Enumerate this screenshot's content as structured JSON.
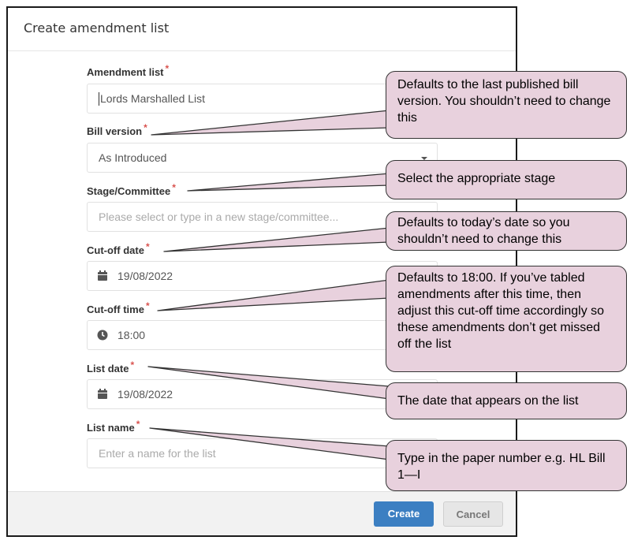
{
  "dialog": {
    "title": "Create amendment list",
    "required_mark": "*",
    "fields": {
      "amendment_list": {
        "label": "Amendment list",
        "value": "Lords Marshalled List"
      },
      "bill_version": {
        "label": "Bill version",
        "value": "As Introduced"
      },
      "stage": {
        "label": "Stage/Committee",
        "placeholder": "Please select or type in a new stage/committee..."
      },
      "cutoff_date": {
        "label": "Cut-off date",
        "value": "19/08/2022"
      },
      "cutoff_time": {
        "label": "Cut-off time",
        "value": "18:00"
      },
      "list_date": {
        "label": "List date",
        "value": "19/08/2022"
      },
      "list_name": {
        "label": "List name",
        "placeholder": "Enter a name for the list"
      }
    },
    "buttons": {
      "create": "Create",
      "cancel": "Cancel"
    }
  },
  "callouts": {
    "bill_version": "Defaults to the last published bill version.  You shouldn’t need to change this",
    "stage": "Select the appropriate stage",
    "cutoff_date": "Defaults to today’s date so you shouldn’t need to change this",
    "cutoff_time": "Defaults to 18:00.  If you’ve tabled amendments after this time, then adjust this cut-off time accordingly so these amendments don’t get missed off the list",
    "list_date": "The date that appears on the list",
    "list_name": "Type in the paper number e.g. HL Bill 1—I"
  },
  "colors": {
    "callout_fill": "#e8d1dd",
    "primary_button": "#3c7fc2",
    "required": "#d9534f"
  }
}
